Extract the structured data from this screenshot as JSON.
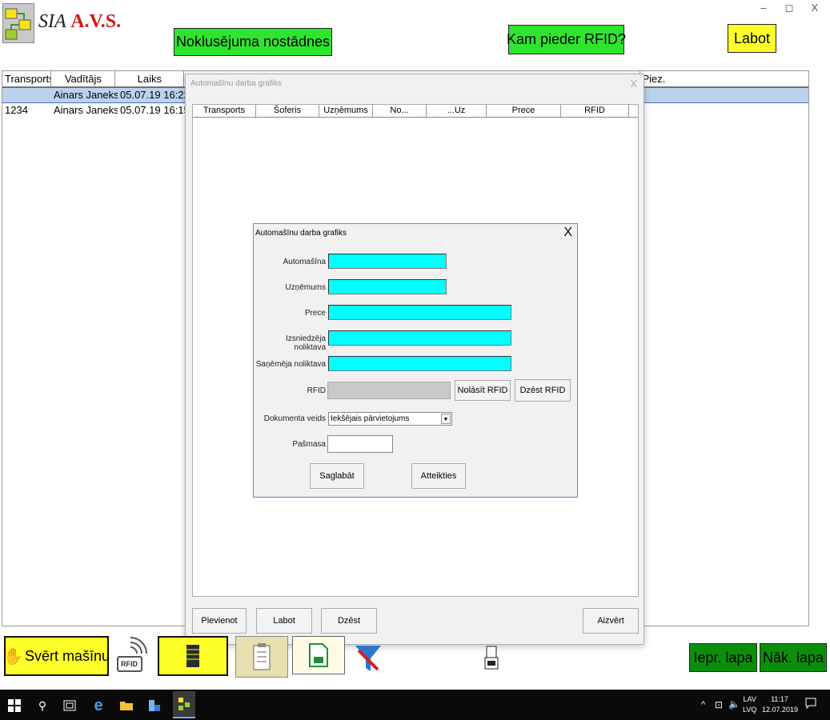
{
  "app": {
    "logo_prefix": "SIA",
    "logo_name": "A.V.S.",
    "window_controls": [
      "–",
      "◻",
      "X"
    ]
  },
  "top_buttons": {
    "defaults": "Noklusējuma nostādnes",
    "rfid_owner": "Kam pieder RFID?",
    "edit": "Labot"
  },
  "main_table": {
    "columns": [
      "Transports",
      "Vadītājs",
      "Laiks",
      "Piez."
    ],
    "rows": [
      {
        "transport": "",
        "driver": "Ainars Janeks",
        "time": "05.07.19 16:22"
      },
      {
        "transport": "1234",
        "driver": "Ainars Janeks",
        "time": "05.07.19 16:15"
      }
    ]
  },
  "schedule_window": {
    "title": "Automašīnu darba grafiks",
    "close": "X",
    "columns": [
      "Transports",
      "Šoferis",
      "Uzņēmums",
      "No...",
      "...Uz",
      "Prece",
      "RFID"
    ],
    "buttons": {
      "add": "Pievienot",
      "edit": "Labot",
      "delete": "Dzēst",
      "close": "Aizvērt"
    }
  },
  "dialog": {
    "title": "Automašīnu darba grafiks",
    "close": "X",
    "fields": {
      "car": {
        "label": "Automašīna",
        "value": ""
      },
      "company": {
        "label": "Uzņēmums",
        "value": ""
      },
      "goods": {
        "label": "Prece",
        "value": ""
      },
      "issuer_warehouse": {
        "label": "Izsniedzēja noliktava",
        "value": ""
      },
      "receiver_warehouse": {
        "label": "Saņēmēja noliktava",
        "value": ""
      },
      "rfid": {
        "label": "RFID",
        "value": ""
      },
      "doc_type": {
        "label": "Dokumenta veids",
        "value": "Iekšējais pārvietojums"
      },
      "tare": {
        "label": "Pašmasa",
        "value": ""
      }
    },
    "buttons": {
      "read_rfid": "Nolāsīt RFID",
      "delete_rfid": "Dzēst RFID",
      "save": "Saglabāt",
      "cancel": "Atteikties"
    }
  },
  "bottom_toolbar": {
    "weigh": "Svērt mašīnu",
    "rfid_icon_text": "RFID",
    "prev_page": "Iepr. lapa",
    "next_page": "Nāk. lapa"
  },
  "taskbar": {
    "lang_top": "LAV",
    "lang_bottom": "LVQ",
    "time": "11:17",
    "date": "12.07.2019"
  }
}
